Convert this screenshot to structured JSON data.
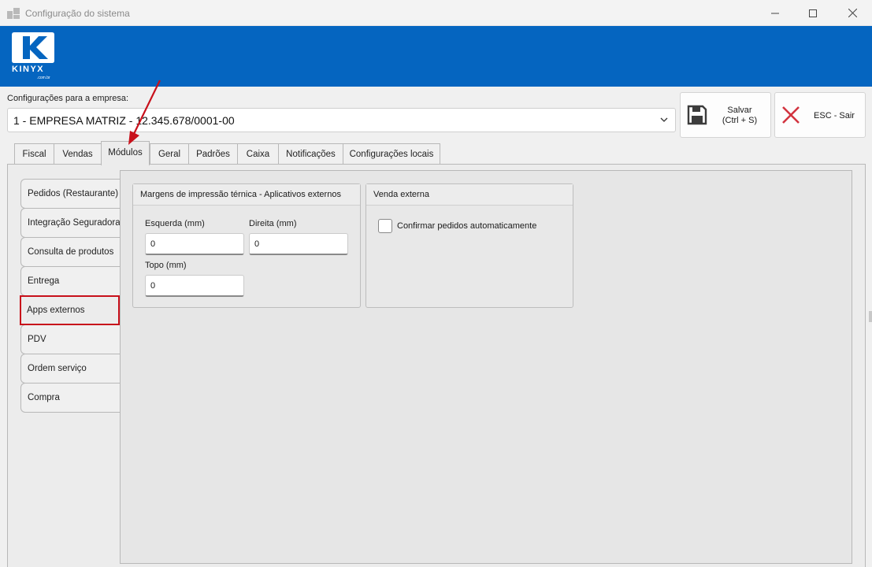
{
  "window": {
    "title": "Configuração do sistema"
  },
  "brand": {
    "word": "KINYX",
    "sub": ".com.br",
    "banner_color": "#0565c0"
  },
  "company": {
    "label": "Configurações para a empresa:",
    "selected": "1 - EMPRESA MATRIZ - 12.345.678/0001-00"
  },
  "actions": {
    "save_line1": "Salvar",
    "save_line2": "(Ctrl + S)",
    "exit_label": "ESC - Sair"
  },
  "tabs": [
    {
      "label": "Fiscal"
    },
    {
      "label": "Vendas"
    },
    {
      "label": "Módulos"
    },
    {
      "label": "Geral"
    },
    {
      "label": "Padrões"
    },
    {
      "label": "Caixa"
    },
    {
      "label": "Notificações"
    },
    {
      "label": "Configurações locais"
    }
  ],
  "side_tabs": [
    {
      "label": "Pedidos (Restaurante)"
    },
    {
      "label": "Integração Seguradora"
    },
    {
      "label": "Consulta de produtos"
    },
    {
      "label": "Entrega"
    },
    {
      "label": "Apps externos"
    },
    {
      "label": "PDV"
    },
    {
      "label": "Ordem serviço"
    },
    {
      "label": "Compra"
    }
  ],
  "margins": {
    "title": "Margens de impressão térnica - Aplicativos externos",
    "left_label": "Esquerda (mm)",
    "left_value": "0",
    "right_label": "Direita (mm)",
    "right_value": "0",
    "top_label": "Topo (mm)",
    "top_value": "0"
  },
  "external_sale": {
    "title": "Venda externa",
    "confirm_label": "Confirmar pedidos automaticamente"
  },
  "colors": {
    "highlight": "#c8101b",
    "close_x": "#d2333f"
  }
}
